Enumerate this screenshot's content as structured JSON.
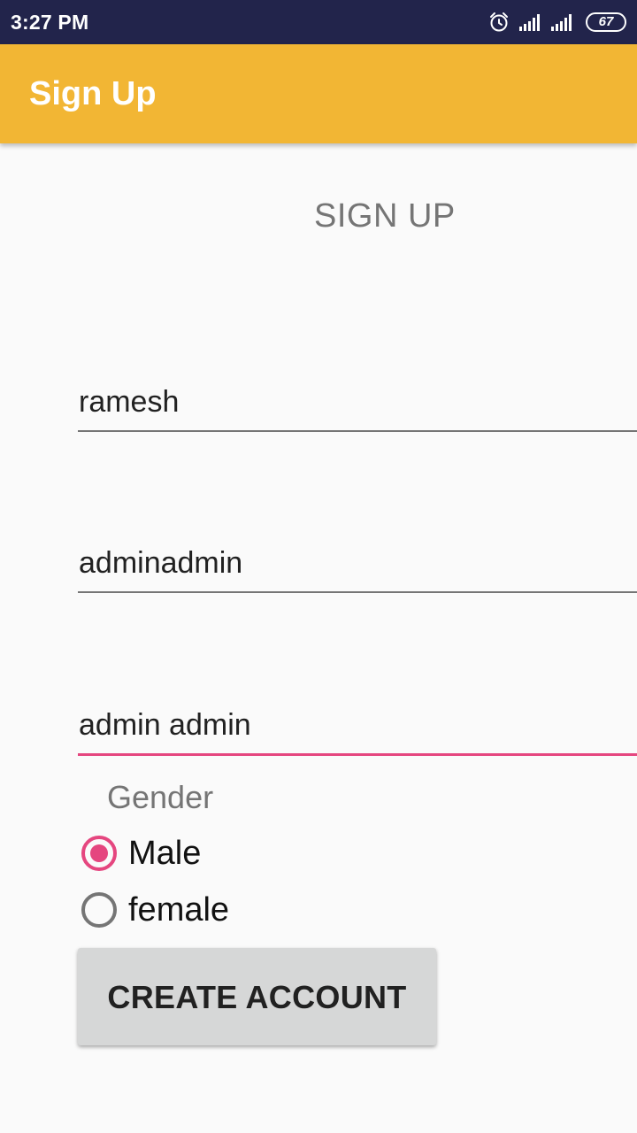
{
  "status_bar": {
    "time": "3:27 PM",
    "battery": "67",
    "icons": [
      "alarm-icon",
      "signal-icon",
      "signal-icon",
      "battery-icon"
    ]
  },
  "app_bar": {
    "title": "Sign Up"
  },
  "form": {
    "heading": "SIGN UP",
    "fields": [
      {
        "value": "ramesh"
      },
      {
        "value": "adminadmin"
      },
      {
        "value": "admin admin",
        "focused": true
      }
    ],
    "gender_label": "Gender",
    "gender_options": [
      {
        "label": "Male",
        "checked": true
      },
      {
        "label": "female",
        "checked": false
      }
    ],
    "submit_label": "CREATE ACCOUNT"
  },
  "colors": {
    "status_bar": "#22244b",
    "app_bar": "#f2b634",
    "accent": "#e5467f",
    "button": "#d6d7d7"
  }
}
